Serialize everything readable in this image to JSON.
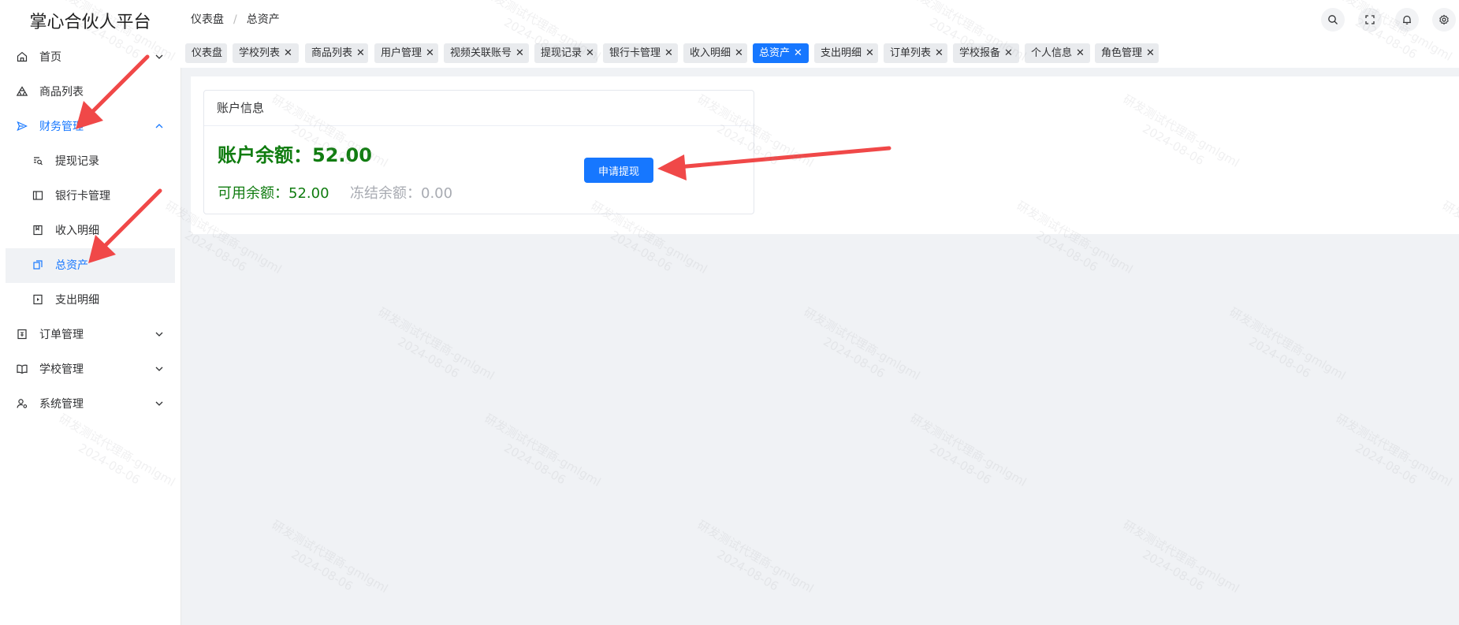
{
  "app": {
    "title": "掌心合伙人平台"
  },
  "breadcrumb": {
    "home": "仪表盘",
    "separator": "/",
    "current": "总资产"
  },
  "sidebar": {
    "items": [
      {
        "label": "首页",
        "icon": "home-icon",
        "expandable": true
      },
      {
        "label": "商品列表",
        "icon": "boxes-icon"
      },
      {
        "label": "财务管理",
        "icon": "send-icon",
        "expandable": true,
        "open": true,
        "children": [
          {
            "label": "提现记录",
            "icon": "search-doc-icon"
          },
          {
            "label": "银行卡管理",
            "icon": "card-icon"
          },
          {
            "label": "收入明细",
            "icon": "bookmark-doc-icon"
          },
          {
            "label": "总资产",
            "icon": "copy-icon",
            "active": true
          },
          {
            "label": "支出明细",
            "icon": "play-doc-icon"
          }
        ]
      },
      {
        "label": "订单管理",
        "icon": "order-icon",
        "expandable": true
      },
      {
        "label": "学校管理",
        "icon": "book-icon",
        "expandable": true
      },
      {
        "label": "系统管理",
        "icon": "user-gear-icon",
        "expandable": true
      }
    ]
  },
  "tabs": [
    {
      "label": "仪表盘",
      "closable": false
    },
    {
      "label": "学校列表",
      "closable": true
    },
    {
      "label": "商品列表",
      "closable": true
    },
    {
      "label": "用户管理",
      "closable": true
    },
    {
      "label": "视频关联账号",
      "closable": true
    },
    {
      "label": "提现记录",
      "closable": true
    },
    {
      "label": "银行卡管理",
      "closable": true
    },
    {
      "label": "收入明细",
      "closable": true
    },
    {
      "label": "总资产",
      "closable": true,
      "active": true
    },
    {
      "label": "支出明细",
      "closable": true
    },
    {
      "label": "订单列表",
      "closable": true
    },
    {
      "label": "学校报备",
      "closable": true
    },
    {
      "label": "个人信息",
      "closable": true
    },
    {
      "label": "角色管理",
      "closable": true
    }
  ],
  "tab_close_glyph": "✕",
  "header_buttons": [
    "search-icon",
    "fullscreen-icon",
    "bell-icon",
    "gear-icon"
  ],
  "account": {
    "card_title": "账户信息",
    "balance": "账户余额：52.00",
    "available": "可用余额：52.00",
    "frozen": "冻结余额：0.00",
    "withdraw_button": "申请提现"
  },
  "watermark": {
    "line1": "研发测试代理商-gmlgml",
    "line2": "2024-08-06"
  },
  "colors": {
    "primary": "#1677ff",
    "balance_green": "#107c10",
    "muted": "#a8abb2",
    "annotation_arrow": "#f04848"
  }
}
